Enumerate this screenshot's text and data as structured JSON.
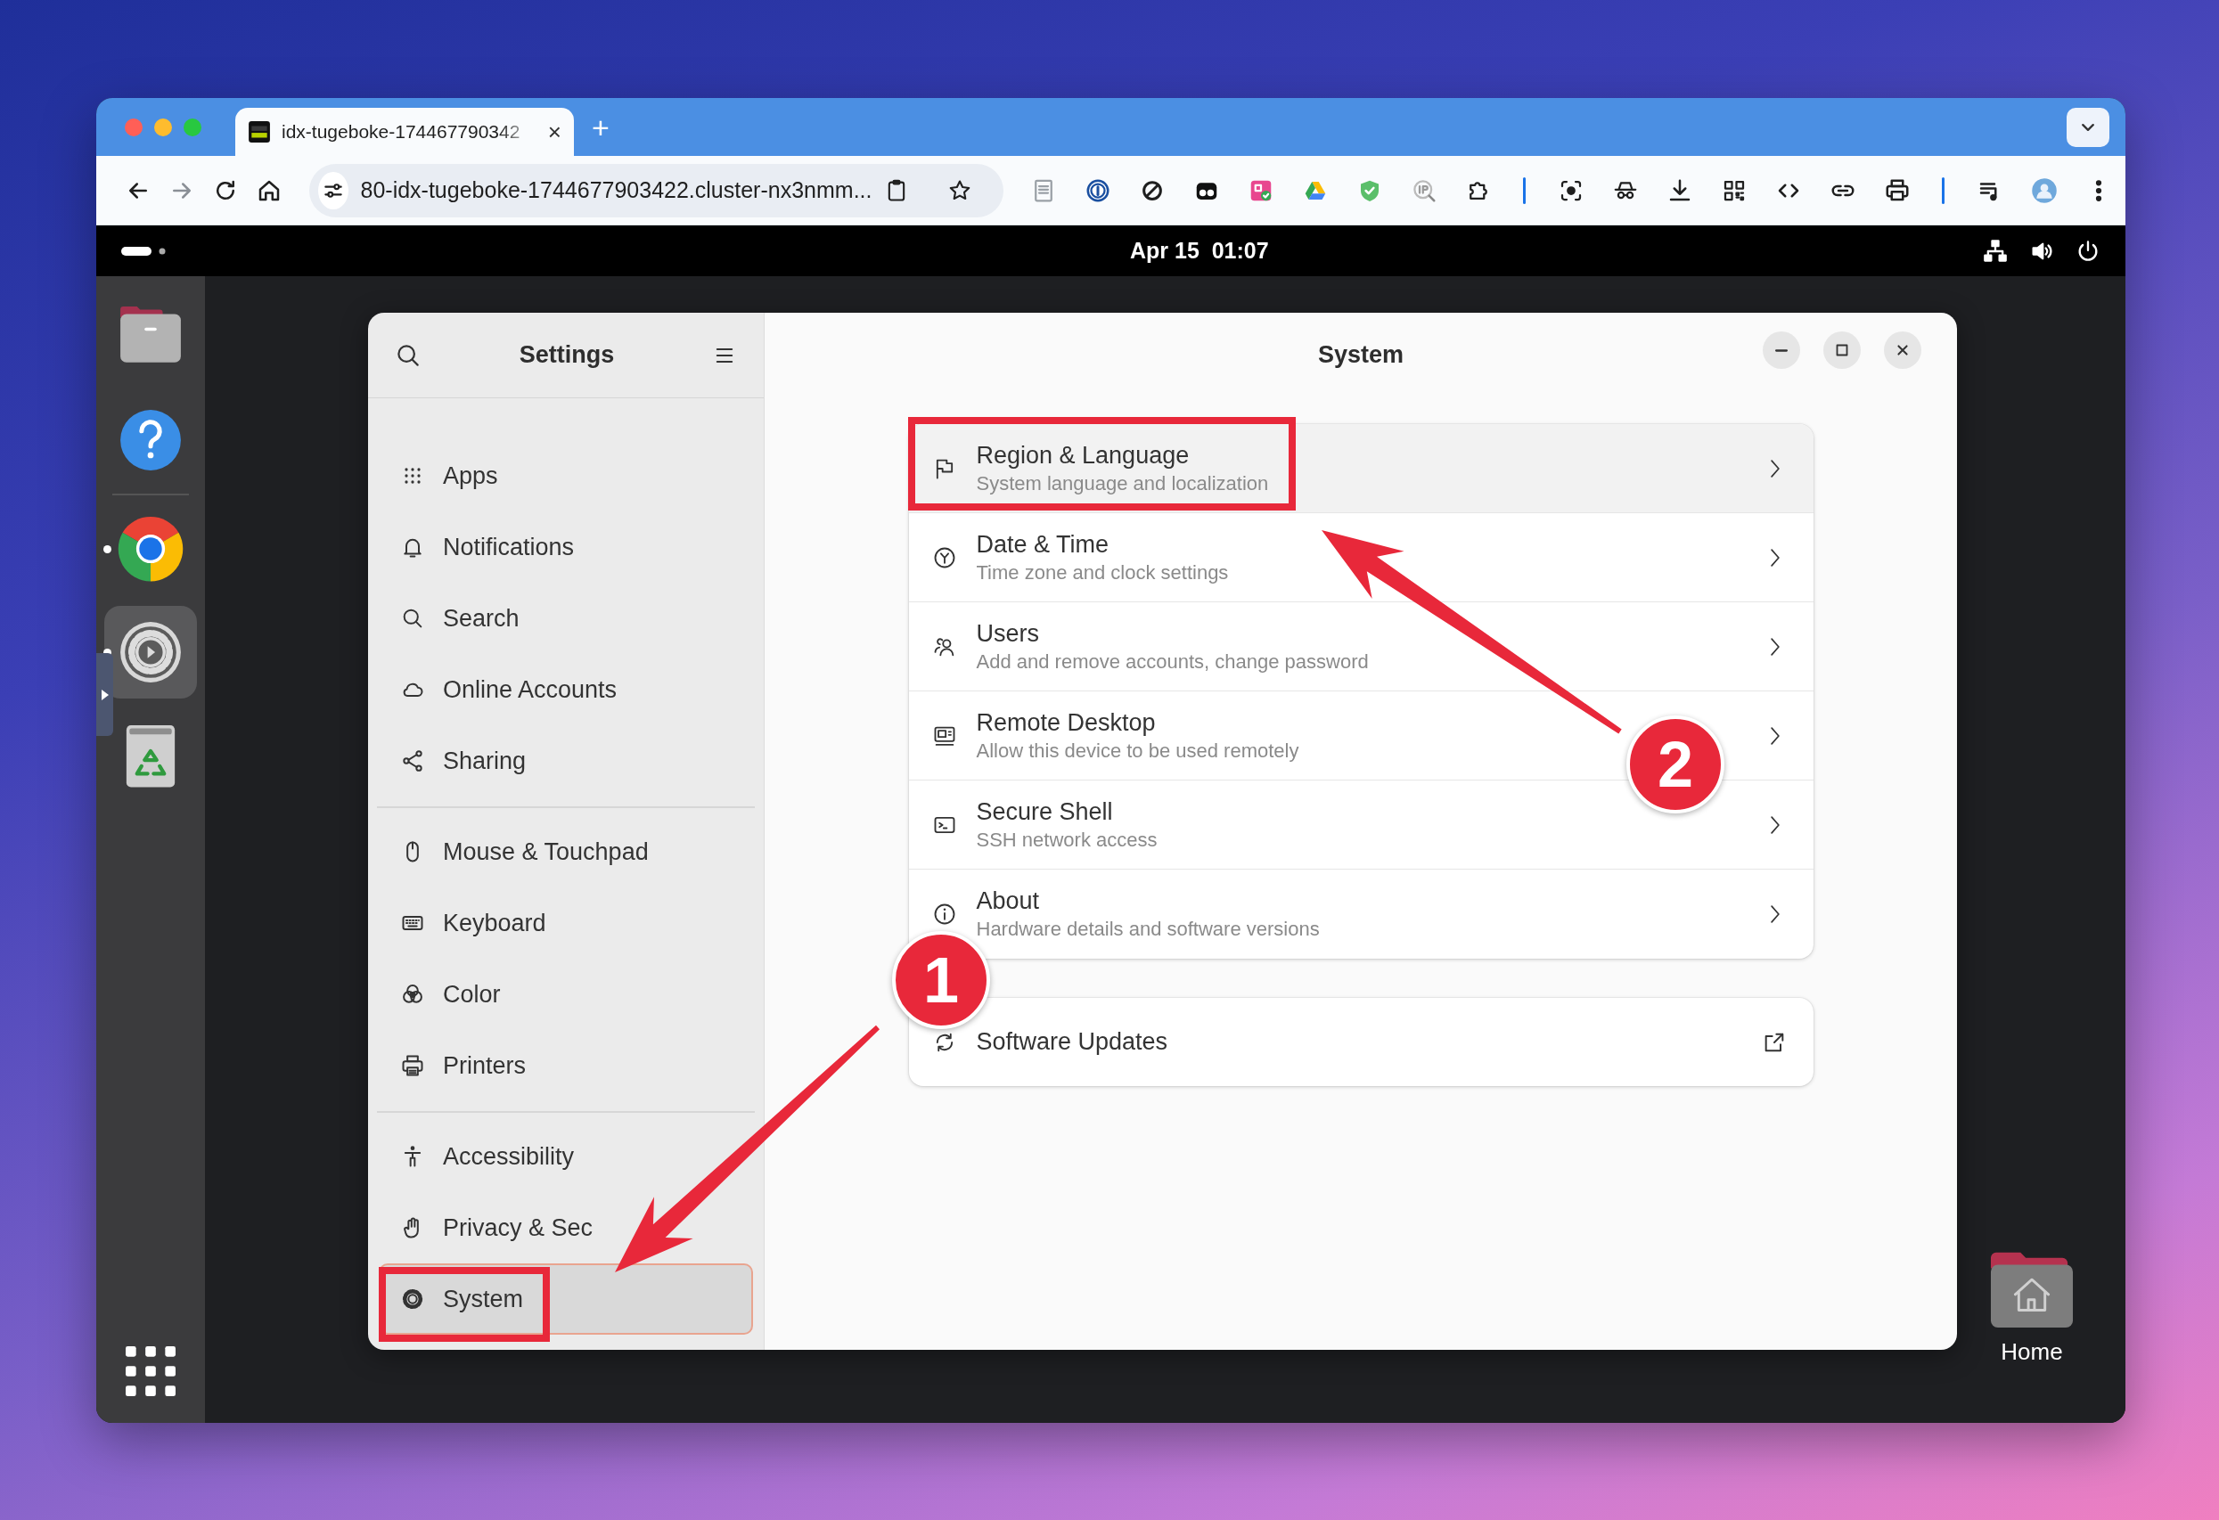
{
  "browser": {
    "tab": {
      "title": "idx-tugeboke-174467790342",
      "close": "×",
      "selected": true
    },
    "new_tab": "+",
    "address": "80-idx-tugeboke-1744677903422.cluster-nx3nmm..."
  },
  "top_bar": {
    "clock": "Apr 15  01:07"
  },
  "dock": {
    "items": [
      {
        "kind": "files",
        "running": false,
        "active": false
      },
      {
        "kind": "help",
        "running": false,
        "active": false
      },
      {
        "kind": "browser",
        "running": true,
        "active": false
      },
      {
        "kind": "settings",
        "running": true,
        "active": true
      },
      {
        "kind": "trash",
        "running": false,
        "active": false
      }
    ]
  },
  "settings": {
    "sidebar": {
      "title": "Settings",
      "groups": [
        {
          "items": [
            {
              "kind": "apps",
              "label": "Apps",
              "selected": false
            },
            {
              "kind": "bell",
              "label": "Notifications",
              "selected": false
            },
            {
              "kind": "search",
              "label": "Search",
              "selected": false
            },
            {
              "kind": "cloud",
              "label": "Online Accounts",
              "selected": false
            },
            {
              "kind": "share",
              "label": "Sharing",
              "selected": false
            }
          ]
        },
        {
          "items": [
            {
              "kind": "mouse",
              "label": "Mouse & Touchpad",
              "selected": false
            },
            {
              "kind": "keyboard",
              "label": "Keyboard",
              "selected": false
            },
            {
              "kind": "color",
              "label": "Color",
              "selected": false
            },
            {
              "kind": "printer",
              "label": "Printers",
              "selected": false
            }
          ]
        },
        {
          "items": [
            {
              "kind": "accessibility",
              "label": "Accessibility",
              "selected": false
            },
            {
              "kind": "hand",
              "label": "Privacy & Sec",
              "selected": false
            },
            {
              "kind": "gear",
              "label": "System",
              "selected": true
            }
          ]
        }
      ]
    },
    "panel": {
      "title": "System",
      "groups": [
        {
          "kind": "list",
          "rows": [
            {
              "kind": "flag",
              "title": "Region & Language",
              "subtitle": "System language and localization",
              "hovered": true
            },
            {
              "kind": "clock",
              "title": "Date & Time",
              "subtitle": "Time zone and clock settings",
              "hovered": false
            },
            {
              "kind": "users",
              "title": "Users",
              "subtitle": "Add and remove accounts, change password",
              "hovered": false
            },
            {
              "kind": "remote",
              "title": "Remote Desktop",
              "subtitle": "Allow this device to be used remotely",
              "hovered": false
            },
            {
              "kind": "terminal",
              "title": "Secure Shell",
              "subtitle": "SSH network access",
              "hovered": false
            },
            {
              "kind": "info",
              "title": "About",
              "subtitle": "Hardware details and software versions",
              "hovered": false
            }
          ]
        },
        {
          "kind": "external",
          "rows": [
            {
              "kind": "refresh",
              "title": "Software Updates",
              "hovered": false
            }
          ]
        }
      ]
    }
  },
  "desktop": {
    "icons": [
      {
        "label": "Home"
      }
    ]
  },
  "annotations": {
    "badges": [
      {
        "label": "1"
      },
      {
        "label": "2"
      }
    ]
  }
}
